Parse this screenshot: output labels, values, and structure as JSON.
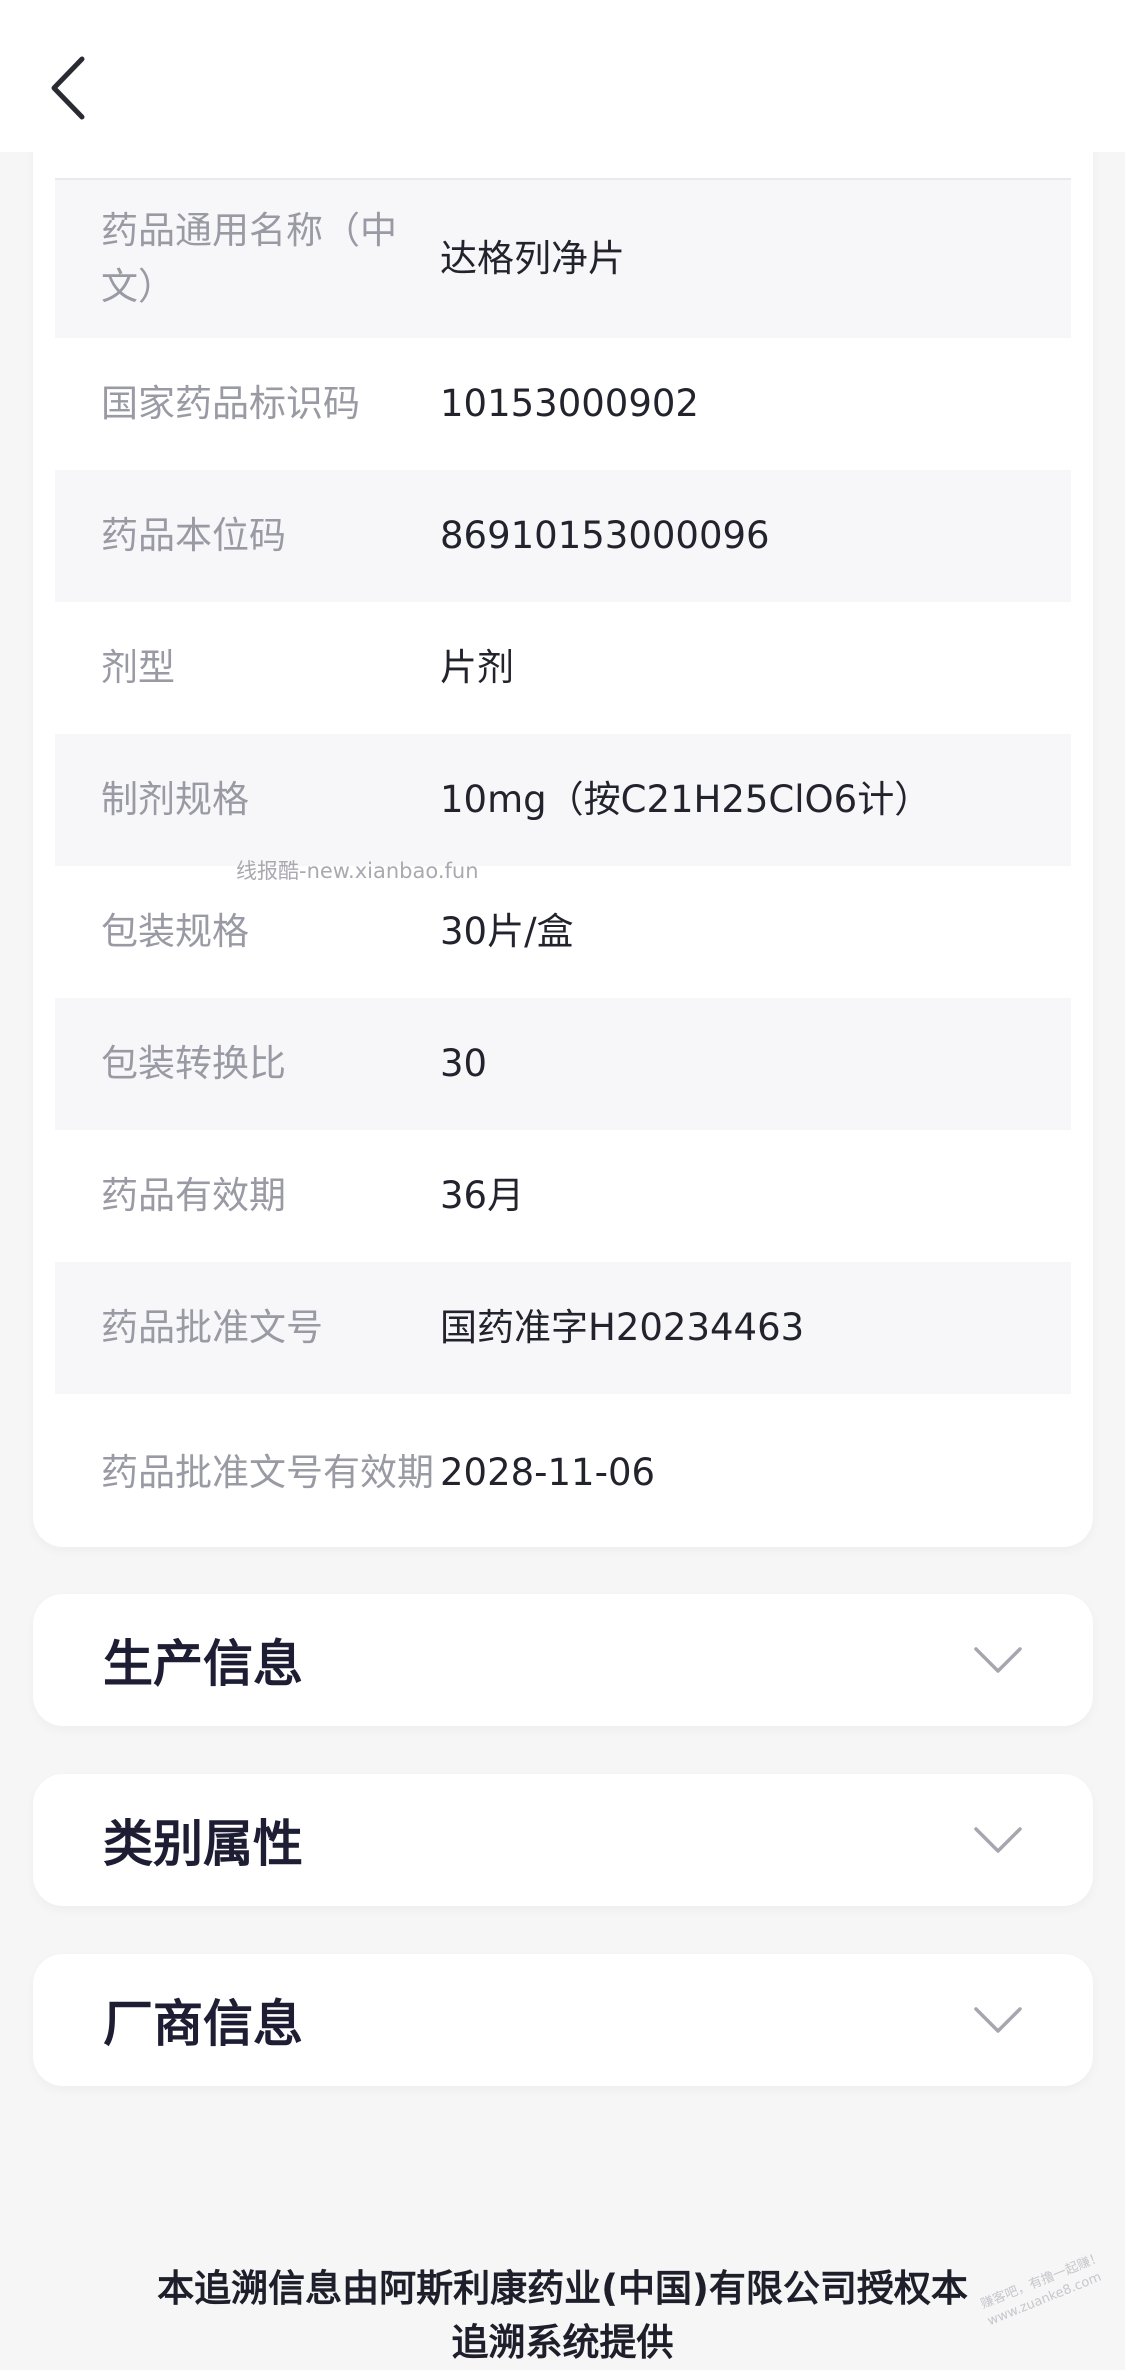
{
  "header": {
    "back_icon": "chevron-left-icon"
  },
  "drug_info": {
    "rows": [
      {
        "label": "药品通用名称（中文）",
        "value": "达格列净片"
      },
      {
        "label": "国家药品标识码",
        "value": "10153000902"
      },
      {
        "label": "药品本位码",
        "value": "86910153000096"
      },
      {
        "label": "剂型",
        "value": "片剂"
      },
      {
        "label": "制剂规格",
        "value": "10mg（按C21H25ClO6计）"
      },
      {
        "label": "包装规格",
        "value": "30片/盒"
      },
      {
        "label": "包装转换比",
        "value": "30"
      },
      {
        "label": "药品有效期",
        "value": "36月"
      },
      {
        "label": "药品批准文号",
        "value": "国药准字H20234463"
      },
      {
        "label": "药品批准文号有效期",
        "value": "2028-11-06"
      }
    ]
  },
  "watermark": "线报酷-new.xianbao.fun",
  "sections": [
    {
      "title": "生产信息",
      "icon": "chevron-down-icon"
    },
    {
      "title": "类别属性",
      "icon": "chevron-down-icon"
    },
    {
      "title": "厂商信息",
      "icon": "chevron-down-icon"
    }
  ],
  "footer": {
    "text": "本追溯信息由阿斯利康药业(中国)有限公司授权本追溯系统提供"
  },
  "corner_watermark": "赚客吧，有撸一起赚！ www.zuanke8.com"
}
